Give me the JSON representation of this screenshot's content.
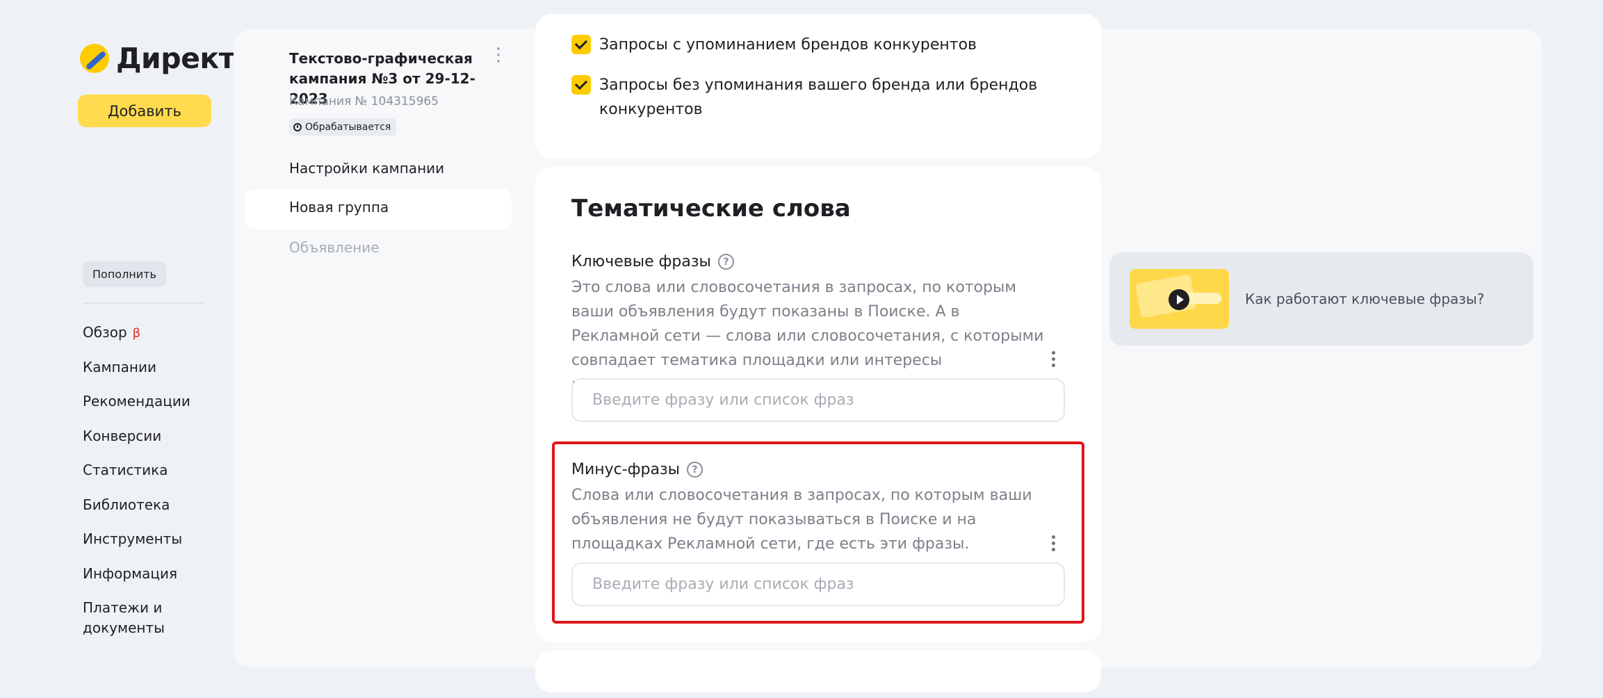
{
  "brand": {
    "logo_text": "Директ",
    "accent": "#ffcc00"
  },
  "sidebar": {
    "add_button": "Добавить",
    "topup_button": "Пополнить",
    "items": [
      {
        "label": "Обзор",
        "badge": "β"
      },
      {
        "label": "Кампании"
      },
      {
        "label": "Рекомендации"
      },
      {
        "label": "Конверсии"
      },
      {
        "label": "Статистика"
      },
      {
        "label": "Библиотека"
      },
      {
        "label": "Инструменты"
      },
      {
        "label": "Информация"
      },
      {
        "label": "Платежи и документы"
      }
    ]
  },
  "campaign": {
    "title": "Текстово-графическая кампания №3 от 29-12-2023",
    "number": "Кампания № 104315965",
    "status": "Обрабатывается",
    "nav": [
      "Настройки кампании",
      "Новая группа",
      "Объявление"
    ]
  },
  "targeting": {
    "options": [
      {
        "label": "Запросы с упоминанием брендов конкурентов",
        "checked": true
      },
      {
        "label": "Запросы без упоминания вашего бренда или брендов конкурентов",
        "checked": true
      }
    ]
  },
  "thematic": {
    "title": "Тематические слова",
    "keywords": {
      "label": "Ключевые фразы",
      "description": "Это слова или словосочетания в запросах, по которым ваши объявления будут показаны в Поиске. А в Рекламной сети — слова или словосочетания, с которыми совпадает тематика площадки или интересы пользователя.",
      "placeholder": "Введите фразу или список фраз",
      "value": ""
    },
    "negative": {
      "label": "Минус-фразы",
      "description": "Слова или словосочетания в запросах, по которым ваши объявления не будут показываться в Поиске и на площадках Рекламной сети, где есть эти фразы.",
      "placeholder": "Введите фразу или список фраз",
      "value": ""
    }
  },
  "video_help": {
    "label": "Как работают ключевые фразы?"
  },
  "colors": {
    "highlight": "#e0161b",
    "button": "#ffdb4d"
  }
}
